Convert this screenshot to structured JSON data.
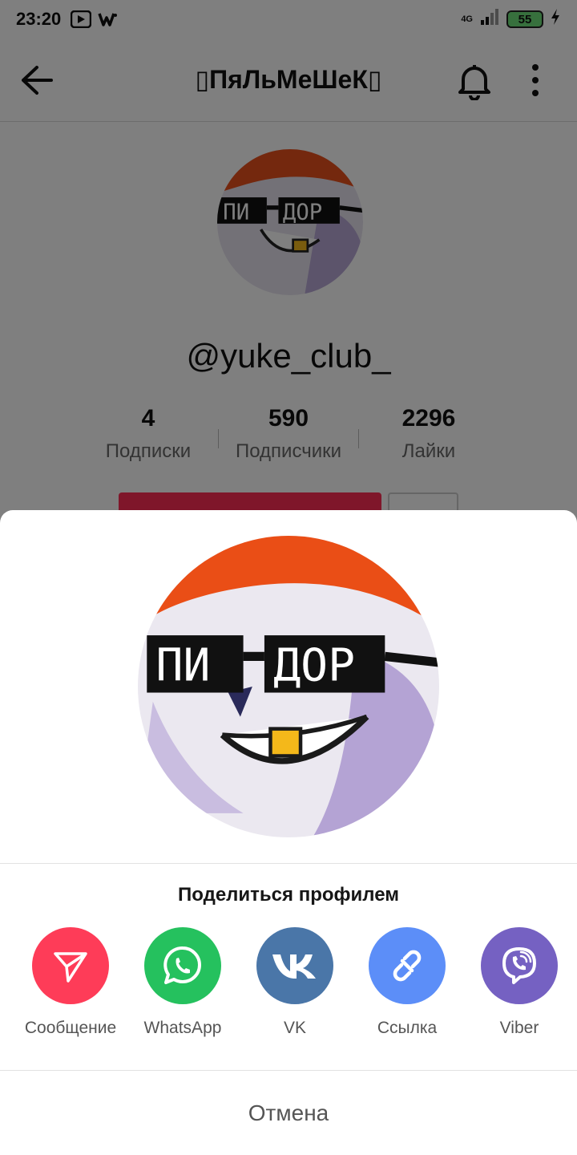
{
  "status_bar": {
    "time": "23:20",
    "network": "4G",
    "battery": "55"
  },
  "profile": {
    "title": "ПяЛьМеШеК",
    "title_brackets": [
      "▯",
      "▯"
    ],
    "handle": "@yuke_club_",
    "avatar_text_left": "ПИ",
    "avatar_text_right": "ДОР",
    "stats": [
      {
        "value": "4",
        "label": "Подписки"
      },
      {
        "value": "590",
        "label": "Подписчики"
      },
      {
        "value": "2296",
        "label": "Лайки"
      }
    ]
  },
  "share_sheet": {
    "title": "Поделиться профилем",
    "items": [
      {
        "label": "Сообщение",
        "icon": "send-icon",
        "color": "#fe3c58"
      },
      {
        "label": "WhatsApp",
        "icon": "whatsapp-icon",
        "color": "#25c15e"
      },
      {
        "label": "VK",
        "icon": "vk-icon",
        "color": "#4a76a8"
      },
      {
        "label": "Ссылка",
        "icon": "link-icon",
        "color": "#5c8ef8"
      },
      {
        "label": "Viber",
        "icon": "viber-icon",
        "color": "#7561c2"
      }
    ],
    "cancel_label": "Отмена"
  },
  "colors": {
    "accent": "#fe2c55",
    "overlay": "rgba(0,0,0,0.5)"
  }
}
